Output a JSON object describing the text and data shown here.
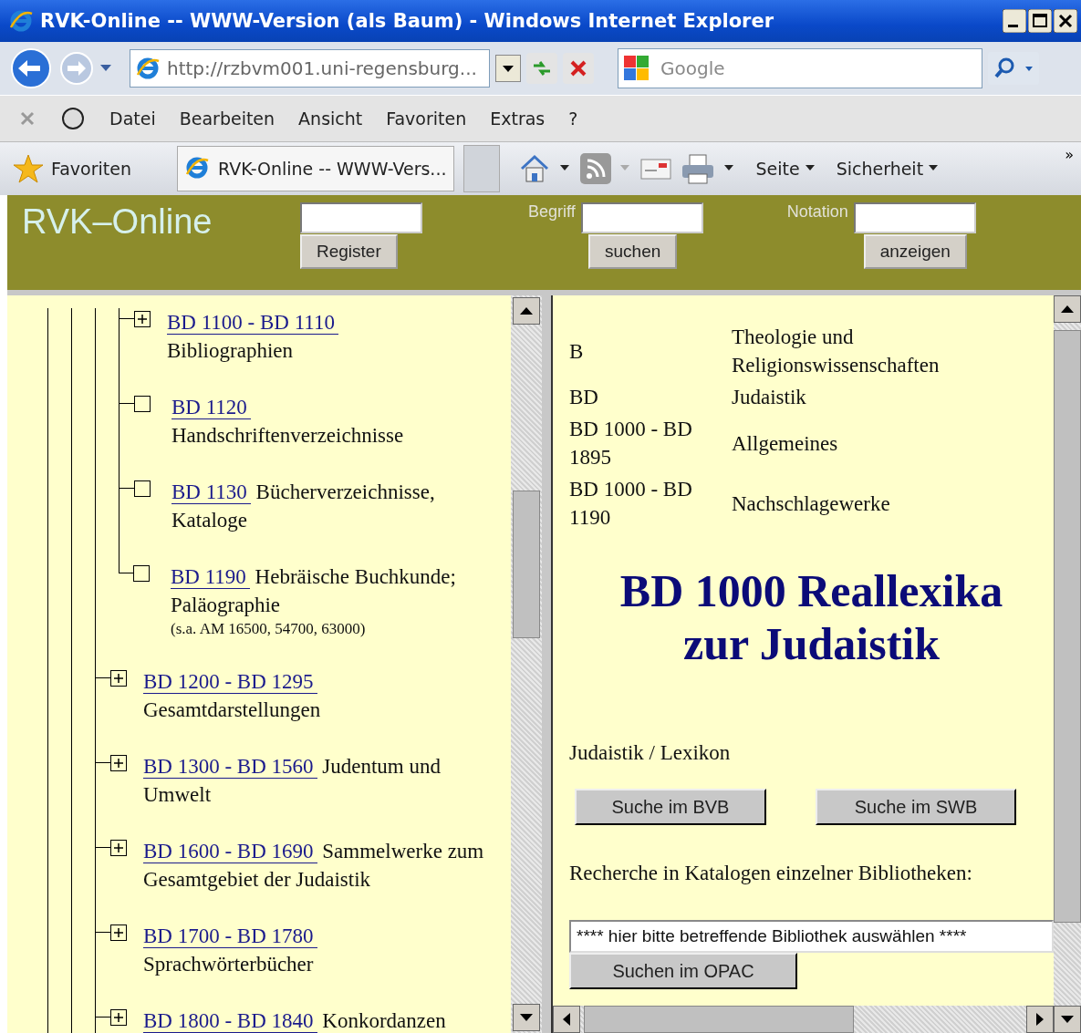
{
  "window": {
    "title": "RVK-Online -- WWW-Version (als Baum) - Windows Internet Explorer"
  },
  "address_bar": {
    "url": "http://rzbvm001.uni-regensburg..."
  },
  "search_box": {
    "placeholder": "Google"
  },
  "menu": [
    "Datei",
    "Bearbeiten",
    "Ansicht",
    "Favoriten",
    "Extras",
    "?"
  ],
  "favorites_bar": {
    "favorites": "Favoriten",
    "tab": "RVK-Online -- WWW-Vers...",
    "commands": [
      "Seite",
      "Sicherheit"
    ],
    "overflow": "»"
  },
  "header": {
    "logo": "RVK–Online",
    "register_button": "Register",
    "term_label": "Begriff",
    "search_button": "suchen",
    "notation_label": "Notation",
    "show_button": "anzeigen"
  },
  "tree": {
    "items": [
      {
        "children": [
          {
            "code": "BD 1100 - BD 1110",
            "title": "Bibliographien",
            "expandable": true
          },
          {
            "code": "BD 1120",
            "title": "Handschriftenverzeichnisse",
            "expandable": false
          },
          {
            "code": "BD 1130",
            "title": "Bücherverzeichnisse, Kataloge",
            "expandable": false
          },
          {
            "code": "BD 1190",
            "title": "Hebräische Buchkunde; Paläographie",
            "note": "(s.a. AM 16500, 54700, 63000)",
            "expandable": false
          }
        ]
      },
      {
        "code": "BD 1200 - BD 1295",
        "title": "Gesamtdarstellungen",
        "expandable": true
      },
      {
        "code": "BD 1300 - BD 1560",
        "title": "Judentum und Umwelt",
        "expandable": true
      },
      {
        "code": "BD 1600 - BD 1690",
        "title": "Sammelwerke zum Gesamtgebiet der Judaistik",
        "expandable": true
      },
      {
        "code": "BD 1700 - BD 1780",
        "title": "Sprachwörterbücher",
        "expandable": true
      },
      {
        "code": "BD 1800 - BD 1840",
        "title": "Konkordanzen",
        "expandable": true
      }
    ]
  },
  "detail": {
    "rows": [
      {
        "notation": "B",
        "name": "Theologie und Religionswissenschaften"
      },
      {
        "notation": "BD",
        "name": "Judaistik"
      },
      {
        "notation": "BD 1000 - BD 1895",
        "name": "Allgemeines"
      },
      {
        "notation": "BD 1000 - BD 1190",
        "name": "Nachschlagewerke"
      }
    ],
    "heading": "BD 1000 Reallexika zur Judaistik",
    "subject": "Judaistik / Lexikon",
    "catalog_buttons": [
      "Suche im BVB",
      "Suche im SWB"
    ],
    "library_prompt": "Recherche in Katalogen einzelner Bibliotheken:",
    "library_select": "**** hier bitte betreffende Bibliothek auswählen ****",
    "opac_button": "Suchen im OPAC"
  }
}
